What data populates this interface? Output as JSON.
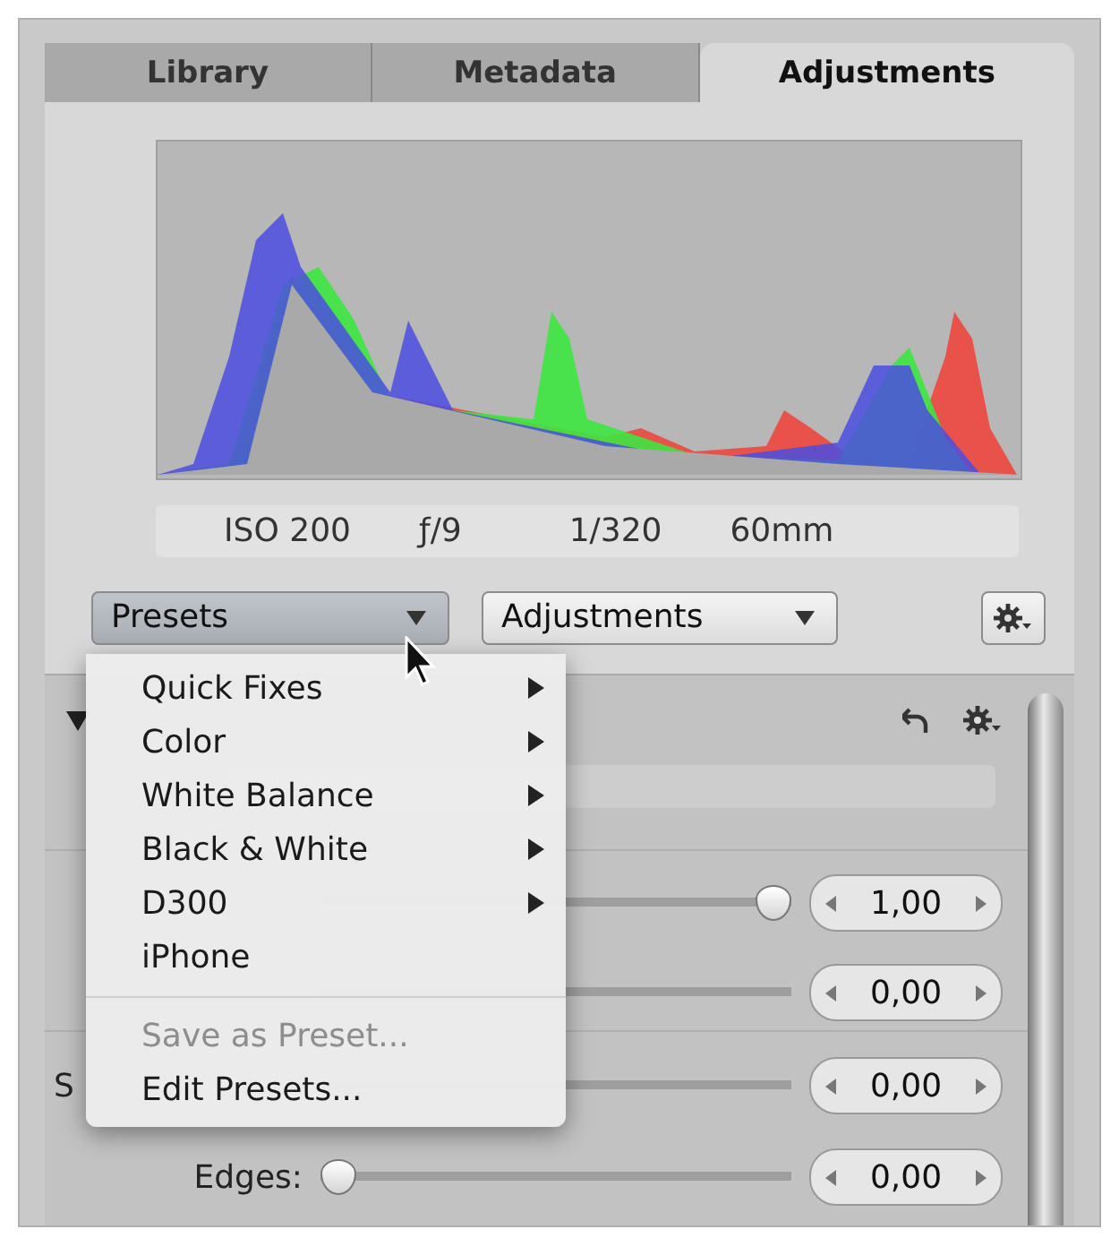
{
  "tabs": [
    {
      "label": "Library",
      "selected": false
    },
    {
      "label": "Metadata",
      "selected": false
    },
    {
      "label": "Adjustments",
      "selected": true
    }
  ],
  "exif": [
    "ISO 200",
    "ƒ/9",
    "1/320",
    "60mm"
  ],
  "toolbar": {
    "presets": "Presets",
    "adjustments": "Adjustments"
  },
  "section": {
    "expanded": true,
    "sliders": [
      {
        "level": 1,
        "value": "1,00"
      },
      {
        "value": "0,00"
      },
      {
        "label": "S",
        "value": "0,00",
        "divider": true
      },
      {
        "label": "Edges:",
        "level": 0,
        "value": "0,00"
      }
    ]
  },
  "menu": {
    "items": [
      {
        "kind": "item",
        "label": "Quick Fixes",
        "submenu": true,
        "disabled": false
      },
      {
        "kind": "item",
        "label": "Color",
        "submenu": true,
        "disabled": false
      },
      {
        "kind": "item",
        "label": "White Balance",
        "submenu": true,
        "disabled": false
      },
      {
        "kind": "item",
        "label": "Black & White",
        "submenu": true,
        "disabled": false
      },
      {
        "kind": "item",
        "label": "D300",
        "submenu": true,
        "disabled": false
      },
      {
        "kind": "item",
        "label": "iPhone",
        "submenu": false,
        "disabled": false
      },
      {
        "kind": "separator"
      },
      {
        "kind": "item",
        "label": "Save as Preset...",
        "submenu": false,
        "disabled": true
      },
      {
        "kind": "item",
        "label": "Edit Presets...",
        "submenu": false,
        "disabled": false
      }
    ]
  }
}
